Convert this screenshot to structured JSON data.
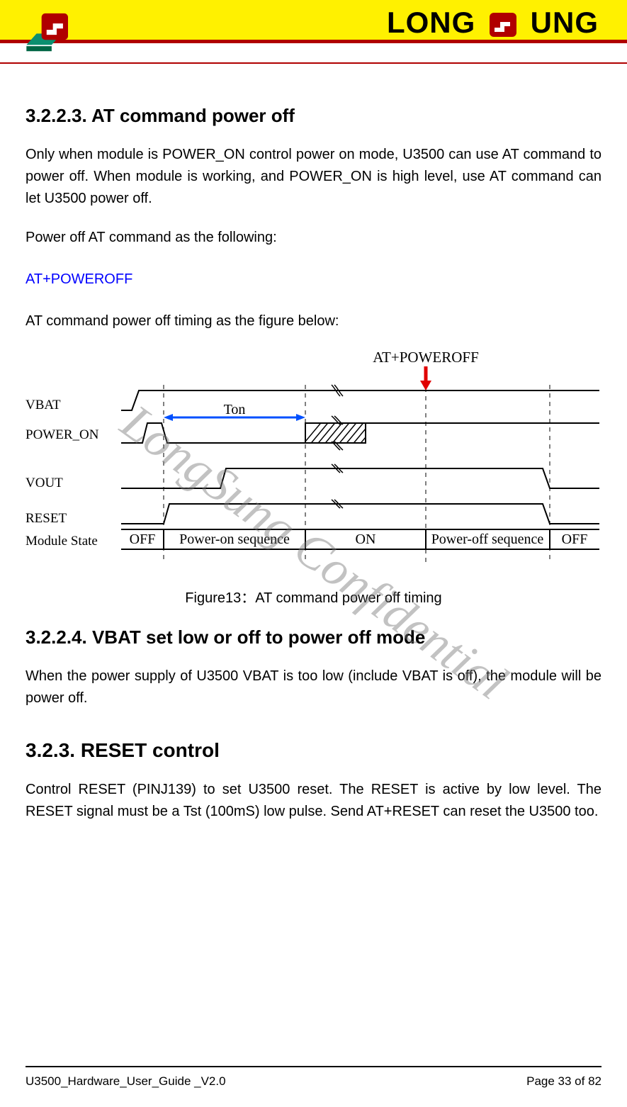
{
  "brand": {
    "text_left": "LONG",
    "text_right": "UNG"
  },
  "watermark": "LongSung Confidential",
  "sections": {
    "s1_title": "3.2.2.3. AT command power off",
    "s1_p1": "Only when module is POWER_ON control power on mode, U3500 can use AT command to power off. When module is working, and POWER_ON is high level, use AT command can let U3500 power off.",
    "s1_p2": "Power off AT command as the following:",
    "s1_cmd": "AT+POWEROFF",
    "s1_p3": "AT command power off timing as the figure below:",
    "fig_caption": "Figure13：AT command power off timing",
    "s2_title": "3.2.2.4. VBAT set low or off to power off mode",
    "s2_p1": "When the power supply of U3500 VBAT is too low (include VBAT is off), the module will be power off.",
    "s3_title": "3.2.3. RESET control",
    "s3_p1": "Control RESET (PINJ139) to set U3500 reset. The RESET is active by low level. The RESET signal must be a Tst (100mS) low pulse. Send AT+RESET can reset the U3500 too."
  },
  "diagram": {
    "event_label": "AT+POWEROFF",
    "signals": {
      "vbat": "VBAT",
      "power_on": "POWER_ON",
      "vout": "VOUT",
      "reset": "RESET",
      "module_state": "Module State"
    },
    "ton_label": "Ton",
    "states": {
      "off1": "OFF",
      "pon": "Power-on sequence",
      "on": "ON",
      "poff": "Power-off sequence",
      "off2": "OFF"
    }
  },
  "footer": {
    "left": "U3500_Hardware_User_Guide _V2.0",
    "right": "Page 33 of 82"
  }
}
